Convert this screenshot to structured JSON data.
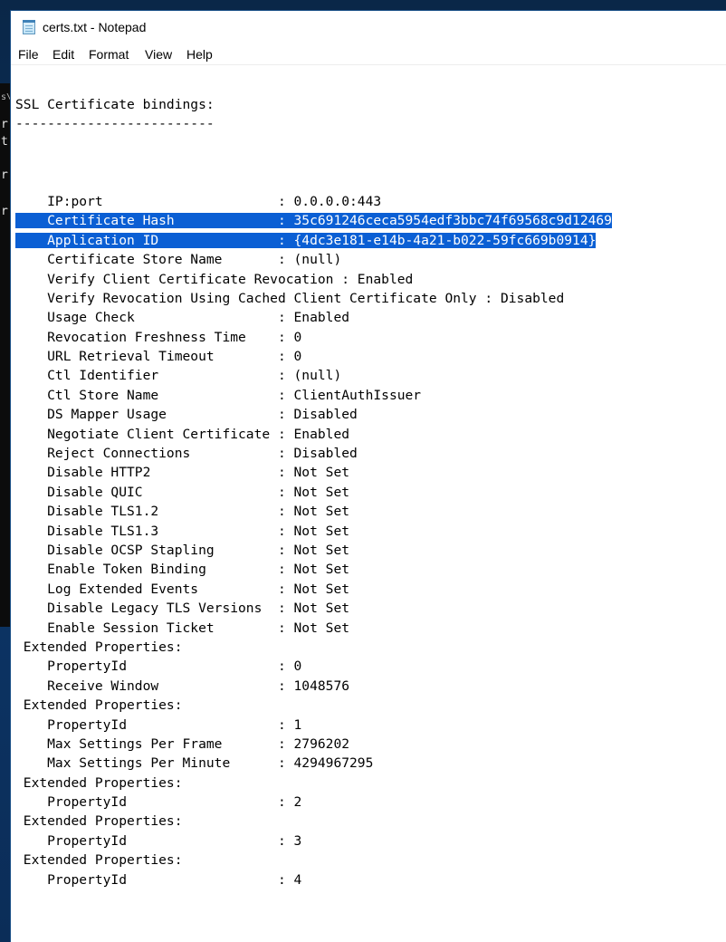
{
  "window": {
    "title": "certs.txt - Notepad"
  },
  "menu": [
    "File",
    "Edit",
    "Format",
    "View",
    "Help"
  ],
  "background_fragments": [
    "s\\",
    "r",
    "t",
    "r",
    "r"
  ],
  "colors": {
    "selection": "#0b5fd4",
    "desktop": "#0d3566"
  },
  "document": {
    "lines": [
      "SSL Certificate bindings:",
      "-------------------------",
      "",
      "",
      "",
      "    IP:port                      : 0.0.0.0:443",
      "    Certificate Hash             : 35c691246ceca5954edf3bbc74f69568c9d12469",
      "    Application ID               : {4dc3e181-e14b-4a21-b022-59fc669b0914}",
      "    Certificate Store Name       : (null)",
      "    Verify Client Certificate Revocation : Enabled",
      "    Verify Revocation Using Cached Client Certificate Only : Disabled",
      "    Usage Check                  : Enabled",
      "    Revocation Freshness Time    : 0",
      "    URL Retrieval Timeout        : 0",
      "    Ctl Identifier               : (null)",
      "    Ctl Store Name               : ClientAuthIssuer",
      "    DS Mapper Usage              : Disabled",
      "    Negotiate Client Certificate : Enabled",
      "    Reject Connections           : Disabled",
      "    Disable HTTP2                : Not Set",
      "    Disable QUIC                 : Not Set",
      "    Disable TLS1.2               : Not Set",
      "    Disable TLS1.3               : Not Set",
      "    Disable OCSP Stapling        : Not Set",
      "    Enable Token Binding         : Not Set",
      "    Log Extended Events          : Not Set",
      "    Disable Legacy TLS Versions  : Not Set",
      "    Enable Session Ticket        : Not Set",
      " Extended Properties:",
      "    PropertyId                   : 0",
      "    Receive Window               : 1048576",
      " Extended Properties:",
      "    PropertyId                   : 1",
      "    Max Settings Per Frame       : 2796202",
      "    Max Settings Per Minute      : 4294967295",
      " Extended Properties:",
      "    PropertyId                   : 2",
      " Extended Properties:",
      "    PropertyId                   : 3",
      " Extended Properties:",
      "    PropertyId                   : 4"
    ],
    "selected_line_indices": [
      6,
      7
    ]
  }
}
